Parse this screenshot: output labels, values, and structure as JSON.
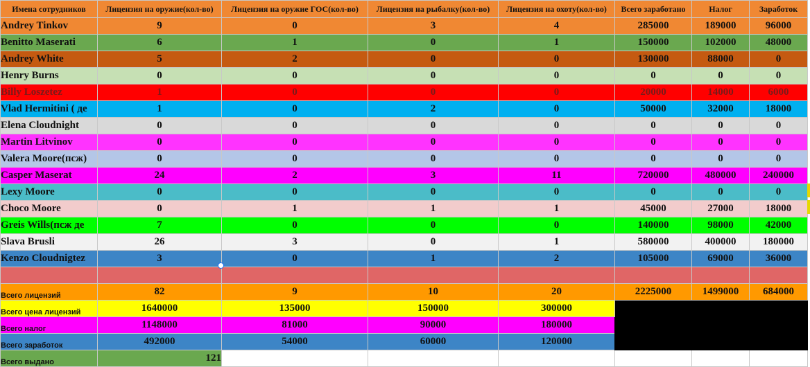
{
  "headers": [
    "Имена сотрудников",
    "Лицензия на оружие(кол-во)",
    "Лицензия на оружие ГОС(кол-во)",
    "Лицензия на рыбалку(кол-во)",
    "Лицензия на охоту(кол-во)",
    "Всего заработано",
    "Налог",
    "Заработок"
  ],
  "rows": [
    {
      "name": "Andrey Tinkov",
      "bg": "#f08833",
      "fg": "#111111",
      "v": [
        "9",
        "0",
        "3",
        "4",
        "285000",
        "189000",
        "96000"
      ]
    },
    {
      "name": "Benitto Maserati",
      "bg": "#6aa84f",
      "fg": "#111111",
      "v": [
        "6",
        "1",
        "0",
        "1",
        "150000",
        "102000",
        "48000"
      ]
    },
    {
      "name": "Andrey White",
      "bg": "#c55a11",
      "fg": "#111111",
      "v": [
        "5",
        "2",
        "0",
        "0",
        "130000",
        "88000",
        "0"
      ]
    },
    {
      "name": "Henry Burns",
      "bg": "#c6e0b4",
      "fg": "#111111",
      "v": [
        "0",
        "0",
        "0",
        "0",
        "0",
        "0",
        "0"
      ]
    },
    {
      "name": "Billy Loszetez",
      "bg": "#ff0000",
      "fg": "#7a1a1a",
      "v": [
        "1",
        "0",
        "0",
        "0",
        "20000",
        "14000",
        "6000"
      ]
    },
    {
      "name": "Vlad Hermitini ( де",
      "bg": "#00b0f0",
      "fg": "#111111",
      "v": [
        "1",
        "0",
        "2",
        "0",
        "50000",
        "32000",
        "18000"
      ]
    },
    {
      "name": "Elena Cloudnight",
      "bg": "#d9d9d9",
      "fg": "#111111",
      "v": [
        "0",
        "0",
        "0",
        "0",
        "0",
        "0",
        "0"
      ]
    },
    {
      "name": "Martin Litvinov",
      "bg": "#ff33ff",
      "fg": "#111111",
      "v": [
        "0",
        "0",
        "0",
        "0",
        "0",
        "0",
        "0"
      ]
    },
    {
      "name": "Valera Moore(псж)",
      "bg": "#b4c6e7",
      "fg": "#111111",
      "v": [
        "0",
        "0",
        "0",
        "0",
        "0",
        "0",
        "0"
      ]
    },
    {
      "name": "Casper Maserat",
      "bg": "#ff00ff",
      "fg": "#111111",
      "v": [
        "24",
        "2",
        "3",
        "11",
        "720000",
        "480000",
        "240000"
      ]
    },
    {
      "name": "Lexy Moore",
      "bg": "#4bbcc8",
      "fg": "#111111",
      "v": [
        "0",
        "0",
        "0",
        "0",
        "0",
        "0",
        "0"
      ]
    },
    {
      "name": "Choco Moore",
      "bg": "#f2cccc",
      "fg": "#111111",
      "v": [
        "0",
        "1",
        "1",
        "1",
        "45000",
        "27000",
        "18000"
      ]
    },
    {
      "name": "Greis Wills(псж де",
      "bg": "#00ff00",
      "fg": "#111111",
      "v": [
        "7",
        "0",
        "0",
        "0",
        "140000",
        "98000",
        "42000"
      ]
    },
    {
      "name": "Slava Brusli",
      "bg": "#f2f2f2",
      "fg": "#111111",
      "v": [
        "26",
        "3",
        "0",
        "1",
        "580000",
        "400000",
        "180000"
      ]
    },
    {
      "name": "Kenzo Cloudnigtez",
      "bg": "#3d85c6",
      "fg": "#111111",
      "v": [
        "3",
        "0",
        "1",
        "2",
        "105000",
        "69000",
        "36000"
      ]
    }
  ],
  "spacer_bg": "#e06666",
  "summary": {
    "total_licenses": {
      "label": "Всего лицензий",
      "bg": "#ff9900",
      "v": [
        "82",
        "9",
        "10",
        "20",
        "2225000",
        "1499000",
        "684000"
      ]
    },
    "total_price": {
      "label": "Всего цена лицензий",
      "bg": "#ffff00",
      "v": [
        "1640000",
        "135000",
        "150000",
        "300000"
      ]
    },
    "total_tax": {
      "label": "Всего налог",
      "bg": "#ff00ff",
      "v": [
        "1148000",
        "81000",
        "90000",
        "180000"
      ]
    },
    "total_earnings": {
      "label": "Всего заработок",
      "bg": "#3d85c6",
      "v": [
        "492000",
        "54000",
        "60000",
        "120000"
      ]
    },
    "total_issued": {
      "label": "Всего выдано",
      "bg": "#6aa84f",
      "value": "121"
    }
  },
  "black_block_color": "#000000"
}
